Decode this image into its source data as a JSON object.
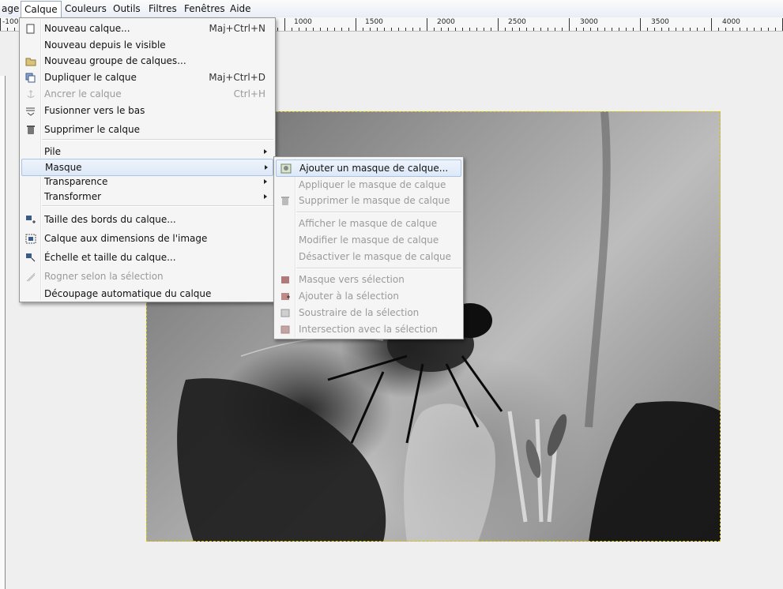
{
  "menubar": {
    "items": [
      "age",
      "Calque",
      "Couleurs",
      "Outils",
      "Filtres",
      "Fenêtres",
      "Aide"
    ]
  },
  "ruler": {
    "labels": [
      "-100",
      "1000",
      "1500",
      "2000",
      "2500",
      "3000",
      "3500",
      "4000"
    ]
  },
  "layer_menu": {
    "items": [
      {
        "label": "Nouveau calque...",
        "shortcut": "Maj+Ctrl+N",
        "icon": "new-layer-icon",
        "disabled": false
      },
      {
        "label": "Nouveau depuis le visible",
        "shortcut": "",
        "icon": "",
        "disabled": false
      },
      {
        "label": "Nouveau groupe de calques...",
        "shortcut": "",
        "icon": "folder-icon",
        "disabled": false
      },
      {
        "label": "Dupliquer le calque",
        "shortcut": "Maj+Ctrl+D",
        "icon": "duplicate-icon",
        "disabled": false
      },
      {
        "label": "Ancrer le calque",
        "shortcut": "Ctrl+H",
        "icon": "anchor-icon",
        "disabled": true
      },
      {
        "label": "Fusionner vers le bas",
        "shortcut": "",
        "icon": "merge-down-icon",
        "disabled": false
      },
      {
        "label": "Supprimer le calque",
        "shortcut": "",
        "icon": "trash-icon",
        "disabled": false
      },
      {
        "label": "Pile",
        "shortcut": "",
        "icon": "",
        "disabled": false
      },
      {
        "label": "Masque",
        "shortcut": "",
        "icon": "",
        "disabled": false
      },
      {
        "label": "Transparence",
        "shortcut": "",
        "icon": "",
        "disabled": false
      },
      {
        "label": "Transformer",
        "shortcut": "",
        "icon": "",
        "disabled": false
      },
      {
        "label": "Taille des bords du calque...",
        "shortcut": "",
        "icon": "layer-boundary-icon",
        "disabled": false
      },
      {
        "label": "Calque aux dimensions de l'image",
        "shortcut": "",
        "icon": "layer-to-image-icon",
        "disabled": false
      },
      {
        "label": "Échelle et taille du calque...",
        "shortcut": "",
        "icon": "scale-layer-icon",
        "disabled": false
      },
      {
        "label": "Rogner selon la sélection",
        "shortcut": "",
        "icon": "crop-icon",
        "disabled": true
      },
      {
        "label": "Découpage automatique du calque",
        "shortcut": "",
        "icon": "",
        "disabled": false
      }
    ]
  },
  "mask_submenu": {
    "items": [
      {
        "label": "Ajouter un masque de calque...",
        "icon": "add-mask-icon",
        "disabled": false
      },
      {
        "label": "Appliquer le masque de calque",
        "icon": "",
        "disabled": true
      },
      {
        "label": "Supprimer le masque de calque",
        "icon": "trash-icon",
        "disabled": true
      },
      {
        "label": "Afficher le masque de calque",
        "icon": "",
        "disabled": true
      },
      {
        "label": "Modifier le masque de calque",
        "icon": "",
        "disabled": true
      },
      {
        "label": "Désactiver le masque de calque",
        "icon": "",
        "disabled": true
      },
      {
        "label": "Masque vers sélection",
        "icon": "mask-to-selection-icon",
        "disabled": true
      },
      {
        "label": "Ajouter à la sélection",
        "icon": "add-to-selection-icon",
        "disabled": true
      },
      {
        "label": "Soustraire de la sélection",
        "icon": "subtract-selection-icon",
        "disabled": true
      },
      {
        "label": "Intersection avec la sélection",
        "icon": "intersect-selection-icon",
        "disabled": true
      }
    ]
  }
}
